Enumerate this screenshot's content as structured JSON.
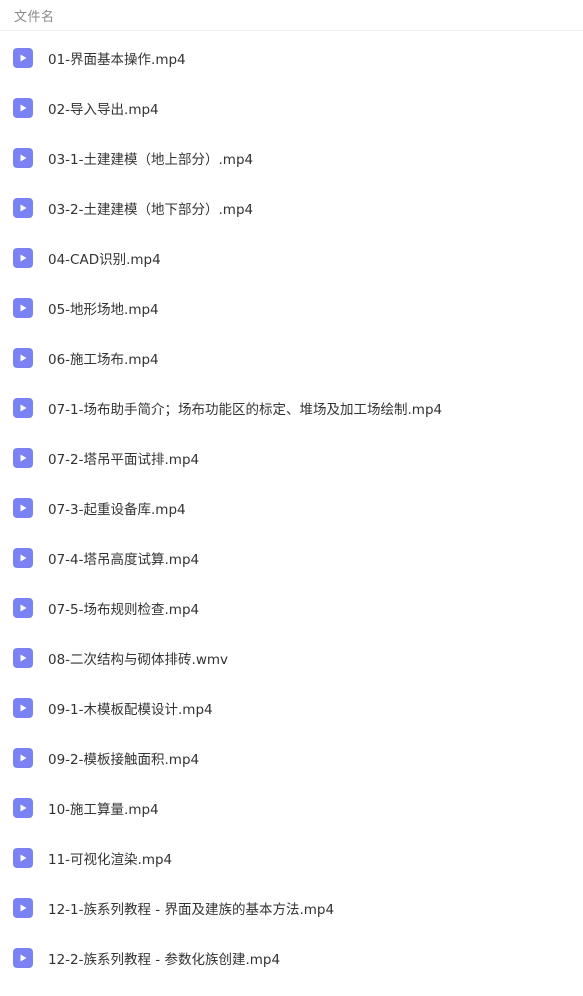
{
  "header": {
    "column_label": "文件名"
  },
  "colors": {
    "icon_bg": "#7b82f3",
    "text": "#333333",
    "header_text": "#8a8a8a"
  },
  "files": [
    {
      "name": "01-界面基本操作.mp4",
      "icon": "video-file-icon"
    },
    {
      "name": "02-导入导出.mp4",
      "icon": "video-file-icon"
    },
    {
      "name": "03-1-土建建模（地上部分）.mp4",
      "icon": "video-file-icon"
    },
    {
      "name": "03-2-土建建模（地下部分）.mp4",
      "icon": "video-file-icon"
    },
    {
      "name": "04-CAD识别.mp4",
      "icon": "video-file-icon"
    },
    {
      "name": "05-地形场地.mp4",
      "icon": "video-file-icon"
    },
    {
      "name": "06-施工场布.mp4",
      "icon": "video-file-icon"
    },
    {
      "name": "07-1-场布助手简介；场布功能区的标定、堆场及加工场绘制.mp4",
      "icon": "video-file-icon"
    },
    {
      "name": "07-2-塔吊平面试排.mp4",
      "icon": "video-file-icon"
    },
    {
      "name": "07-3-起重设备库.mp4",
      "icon": "video-file-icon"
    },
    {
      "name": "07-4-塔吊高度试算.mp4",
      "icon": "video-file-icon"
    },
    {
      "name": "07-5-场布规则检查.mp4",
      "icon": "video-file-icon"
    },
    {
      "name": "08-二次结构与砌体排砖.wmv",
      "icon": "video-file-icon"
    },
    {
      "name": "09-1-木模板配模设计.mp4",
      "icon": "video-file-icon"
    },
    {
      "name": "09-2-模板接触面积.mp4",
      "icon": "video-file-icon"
    },
    {
      "name": "10-施工算量.mp4",
      "icon": "video-file-icon"
    },
    {
      "name": "11-可视化渲染.mp4",
      "icon": "video-file-icon"
    },
    {
      "name": "12-1-族系列教程 - 界面及建族的基本方法.mp4",
      "icon": "video-file-icon"
    },
    {
      "name": "12-2-族系列教程 - 参数化族创建.mp4",
      "icon": "video-file-icon"
    }
  ]
}
